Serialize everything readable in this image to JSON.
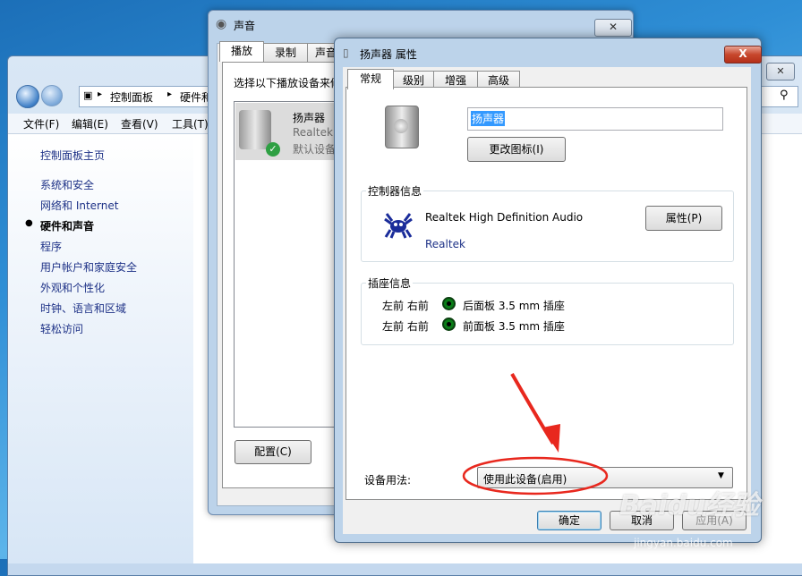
{
  "control_panel": {
    "breadcrumb": [
      "控制面板",
      "硬件和"
    ],
    "menu": [
      "文件(F)",
      "编辑(E)",
      "查看(V)",
      "工具(T)"
    ],
    "sidebar": [
      {
        "label": "控制面板主页",
        "bold": false
      },
      {
        "label": "系统和安全",
        "bold": false
      },
      {
        "label": "网络和 Internet",
        "bold": false
      },
      {
        "label": "硬件和声音",
        "bold": true
      },
      {
        "label": "程序",
        "bold": false
      },
      {
        "label": "用户帐户和家庭安全",
        "bold": false
      },
      {
        "label": "外观和个性化",
        "bold": false
      },
      {
        "label": "时钟、语言和区域",
        "bold": false
      },
      {
        "label": "轻松访问",
        "bold": false
      }
    ]
  },
  "sound_dialog": {
    "title": "声音",
    "tabs": [
      "播放",
      "录制",
      "声音"
    ],
    "instruction": "选择以下播放设备来修",
    "device": {
      "name": "扬声器",
      "driver": "Realtek",
      "status": "默认设备"
    },
    "configure_button": "配置(C)"
  },
  "properties_dialog": {
    "title": "扬声器 属性",
    "close_label": "X",
    "tabs": [
      "常规",
      "级别",
      "增强",
      "高级"
    ],
    "device_name_value": "扬声器",
    "change_icon_button": "更改图标(I)",
    "controller_group": "控制器信息",
    "controller_name": "Realtek High Definition Audio",
    "controller_vendor": "Realtek",
    "properties_button": "属性(P)",
    "jack_group": "插座信息",
    "jacks": [
      {
        "channels": "左前 右前",
        "location": "后面板 3.5 mm 插座"
      },
      {
        "channels": "左前 右前",
        "location": "前面板 3.5 mm 插座"
      }
    ],
    "device_usage_label": "设备用法:",
    "device_usage_value": "使用此设备(启用)",
    "ok_button": "确定",
    "cancel_button": "取消",
    "apply_button": "应用(A)"
  },
  "watermark": {
    "line1": "Baidu经验",
    "line2": "jingyan.baidu.com"
  },
  "colors": {
    "annotation_red": "#e8281e",
    "link_blue": "#1e3287",
    "selection_blue": "#3399ff"
  }
}
